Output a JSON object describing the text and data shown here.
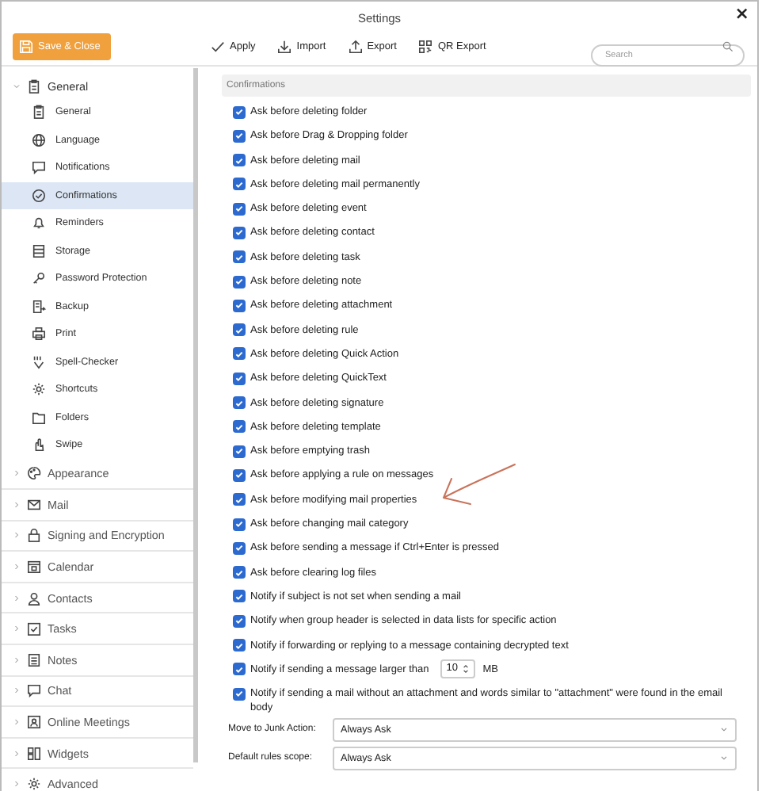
{
  "window": {
    "title": "Settings",
    "close": "×"
  },
  "toolbar": {
    "save_button": "Save & Close",
    "actions": [
      {
        "label": "Apply"
      },
      {
        "label": "Import"
      },
      {
        "label": "Export"
      },
      {
        "label": "QR Export"
      }
    ],
    "search": {
      "placeholder": "Search"
    }
  },
  "sidebar": {
    "sections": [
      {
        "label": "General",
        "expanded": true,
        "children": [
          {
            "label": "General",
            "selected": false
          },
          {
            "label": "Language",
            "selected": false
          },
          {
            "label": "Notifications",
            "selected": false
          },
          {
            "label": "Confirmations",
            "selected": true
          },
          {
            "label": "Reminders",
            "selected": false
          },
          {
            "label": "Storage",
            "selected": false
          },
          {
            "label": "Password Protection",
            "selected": false
          },
          {
            "label": "Backup",
            "selected": false
          },
          {
            "label": "Print",
            "selected": false
          },
          {
            "label": "Spell-Checker",
            "selected": false
          },
          {
            "label": "Shortcuts",
            "selected": false
          },
          {
            "label": "Folders",
            "selected": false
          },
          {
            "label": "Swipe",
            "selected": false
          }
        ]
      },
      {
        "label": "Appearance",
        "expanded": false
      },
      {
        "label": "Mail",
        "expanded": false
      },
      {
        "label": "Signing and Encryption",
        "expanded": false
      },
      {
        "label": "Calendar",
        "expanded": false
      },
      {
        "label": "Contacts",
        "expanded": false
      },
      {
        "label": "Tasks",
        "expanded": false
      },
      {
        "label": "Notes",
        "expanded": false
      },
      {
        "label": "Chat",
        "expanded": false
      },
      {
        "label": "Online Meetings",
        "expanded": false
      },
      {
        "label": "Widgets",
        "expanded": false
      },
      {
        "label": "Advanced",
        "expanded": false
      }
    ]
  },
  "panel": {
    "title": "Confirmations",
    "options": [
      {
        "kind": "checkbox",
        "label": "Ask before deleting folder",
        "checked": true
      },
      {
        "kind": "checkbox",
        "label": "Ask before Drag & Dropping folder",
        "checked": true
      },
      {
        "kind": "checkbox",
        "label": "Ask before deleting mail",
        "checked": true
      },
      {
        "kind": "checkbox",
        "label": "Ask before deleting mail permanently",
        "checked": true
      },
      {
        "kind": "checkbox",
        "label": "Ask before deleting event",
        "checked": true
      },
      {
        "kind": "checkbox",
        "label": "Ask before deleting contact",
        "checked": true
      },
      {
        "kind": "checkbox",
        "label": "Ask before deleting task",
        "checked": true
      },
      {
        "kind": "checkbox",
        "label": "Ask before deleting note",
        "checked": true
      },
      {
        "kind": "checkbox",
        "label": "Ask before deleting attachment",
        "checked": true
      },
      {
        "kind": "checkbox",
        "label": "Ask before deleting rule",
        "checked": true
      },
      {
        "kind": "checkbox",
        "label": "Ask before deleting Quick Action",
        "checked": true
      },
      {
        "kind": "checkbox",
        "label": "Ask before deleting QuickText",
        "checked": true
      },
      {
        "kind": "checkbox",
        "label": "Ask before deleting signature",
        "checked": true
      },
      {
        "kind": "checkbox",
        "label": "Ask before deleting template",
        "checked": true
      },
      {
        "kind": "checkbox",
        "label": "Ask before emptying trash",
        "checked": true
      },
      {
        "kind": "checkbox",
        "label": "Ask before applying a rule on messages",
        "checked": true
      },
      {
        "kind": "checkbox",
        "label": "Ask before modifying mail properties",
        "checked": true
      },
      {
        "kind": "checkbox",
        "label": "Ask before changing mail category",
        "checked": true
      },
      {
        "kind": "checkbox",
        "label": "Ask before sending a message if Ctrl+Enter is pressed",
        "checked": true
      },
      {
        "kind": "checkbox",
        "label": "Ask before clearing log files",
        "checked": true
      },
      {
        "kind": "checkbox",
        "label": "Notify if subject is not set when sending a mail",
        "checked": true
      },
      {
        "kind": "checkbox",
        "label": "Notify when group header is selected in data lists for specific action",
        "checked": true
      },
      {
        "kind": "checkbox",
        "label": "Notify if forwarding or replying to a message containing decrypted text",
        "checked": true
      },
      {
        "kind": "size-limit",
        "label": "Notify if sending a message larger than",
        "checked": true,
        "value": "10",
        "unit": "MB"
      },
      {
        "kind": "checkbox",
        "label": "Notify if sending a mail without an attachment and words similar to \"attachment\" were found in the email body",
        "checked": true
      }
    ],
    "dropdowns": [
      {
        "label": "Move to Junk Action:",
        "value": "Always Ask"
      },
      {
        "label": "Default rules scope:",
        "value": "Always Ask"
      }
    ]
  }
}
